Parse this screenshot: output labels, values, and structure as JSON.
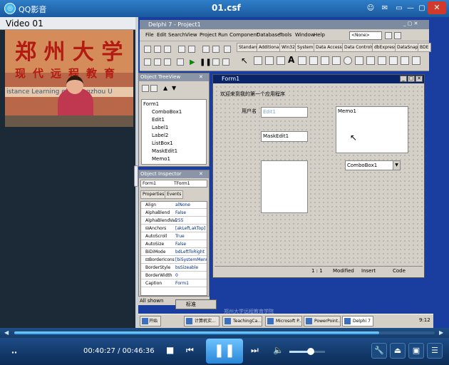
{
  "player": {
    "app_name": "QQ影音",
    "file_name": "01.csf",
    "title_buttons": [
      "☺",
      "✉",
      "▭",
      "—",
      "▢"
    ],
    "close_label": "✕",
    "playlist_label": "Video 01",
    "time_text": "00:40:27 / 00:46:36",
    "progress_fraction": 0.868,
    "volume_fraction": 0.6,
    "accent": "#2b9be8"
  },
  "video_overlay": {
    "line1": "郑 州 大 学",
    "line2": "现代远程教育",
    "line3": "istance Learning of Zhengzhou U"
  },
  "delphi": {
    "title": "Delphi 7 - Project1",
    "menu": [
      "File",
      "Edit",
      "Search",
      "View",
      "Project",
      "Run",
      "Component",
      "Database",
      "Tools",
      "Window",
      "Help"
    ],
    "none_box": "<None>",
    "palette_tabs": [
      "Standard",
      "Additional",
      "Win32",
      "System",
      "Data Access",
      "Data Controls",
      "dbExpress",
      "DataSnap",
      "BDE"
    ]
  },
  "treeview": {
    "title": "Object TreeView",
    "items": [
      "Form1",
      "ComboBox1",
      "Edit1",
      "Label1",
      "Label2",
      "ListBox1",
      "MaskEdit1",
      "Memo1"
    ]
  },
  "inspector": {
    "title": "Object Inspector",
    "selected": "Form1",
    "selected_type": "TForm1",
    "tabs": [
      "Properties",
      "Events"
    ],
    "rows": [
      {
        "k": "Align",
        "v": "alNone"
      },
      {
        "k": "AlphaBlend",
        "v": "False"
      },
      {
        "k": "AlphaBlendVal",
        "v": "255"
      },
      {
        "k": "⊟Anchors",
        "v": "[akLeft,akTop]"
      },
      {
        "k": "AutoScroll",
        "v": "True"
      },
      {
        "k": "AutoSize",
        "v": "False"
      },
      {
        "k": "BiDiMode",
        "v": "bdLeftToRight"
      },
      {
        "k": "⊟BorderIcons",
        "v": "[biSystemMenu"
      },
      {
        "k": "BorderStyle",
        "v": "bsSizeable"
      },
      {
        "k": "BorderWidth",
        "v": "0"
      },
      {
        "k": "Caption",
        "v": "Form1"
      }
    ],
    "footer": "All shown"
  },
  "form": {
    "title": "Form1",
    "caption_text": "欢迎来到我的第一个应用程序",
    "label_text": "用户名",
    "edit_text": "Edit1",
    "maskedit_text": "MaskEdit1",
    "memo_text": "Memo1",
    "combo_text": "ComboBox1",
    "status": [
      "1 : 1",
      "Modified",
      "Insert",
      "Code"
    ]
  },
  "ime_label": "标准",
  "subtitle_text": "郑州大学远程教育学院",
  "vtaskbar": {
    "start": "开始",
    "tasks": [
      "计算机实...",
      "TeachingCa...",
      "Microsoft P...",
      "PowerPoint...",
      "Delphi 7"
    ],
    "clock": "9:12"
  }
}
